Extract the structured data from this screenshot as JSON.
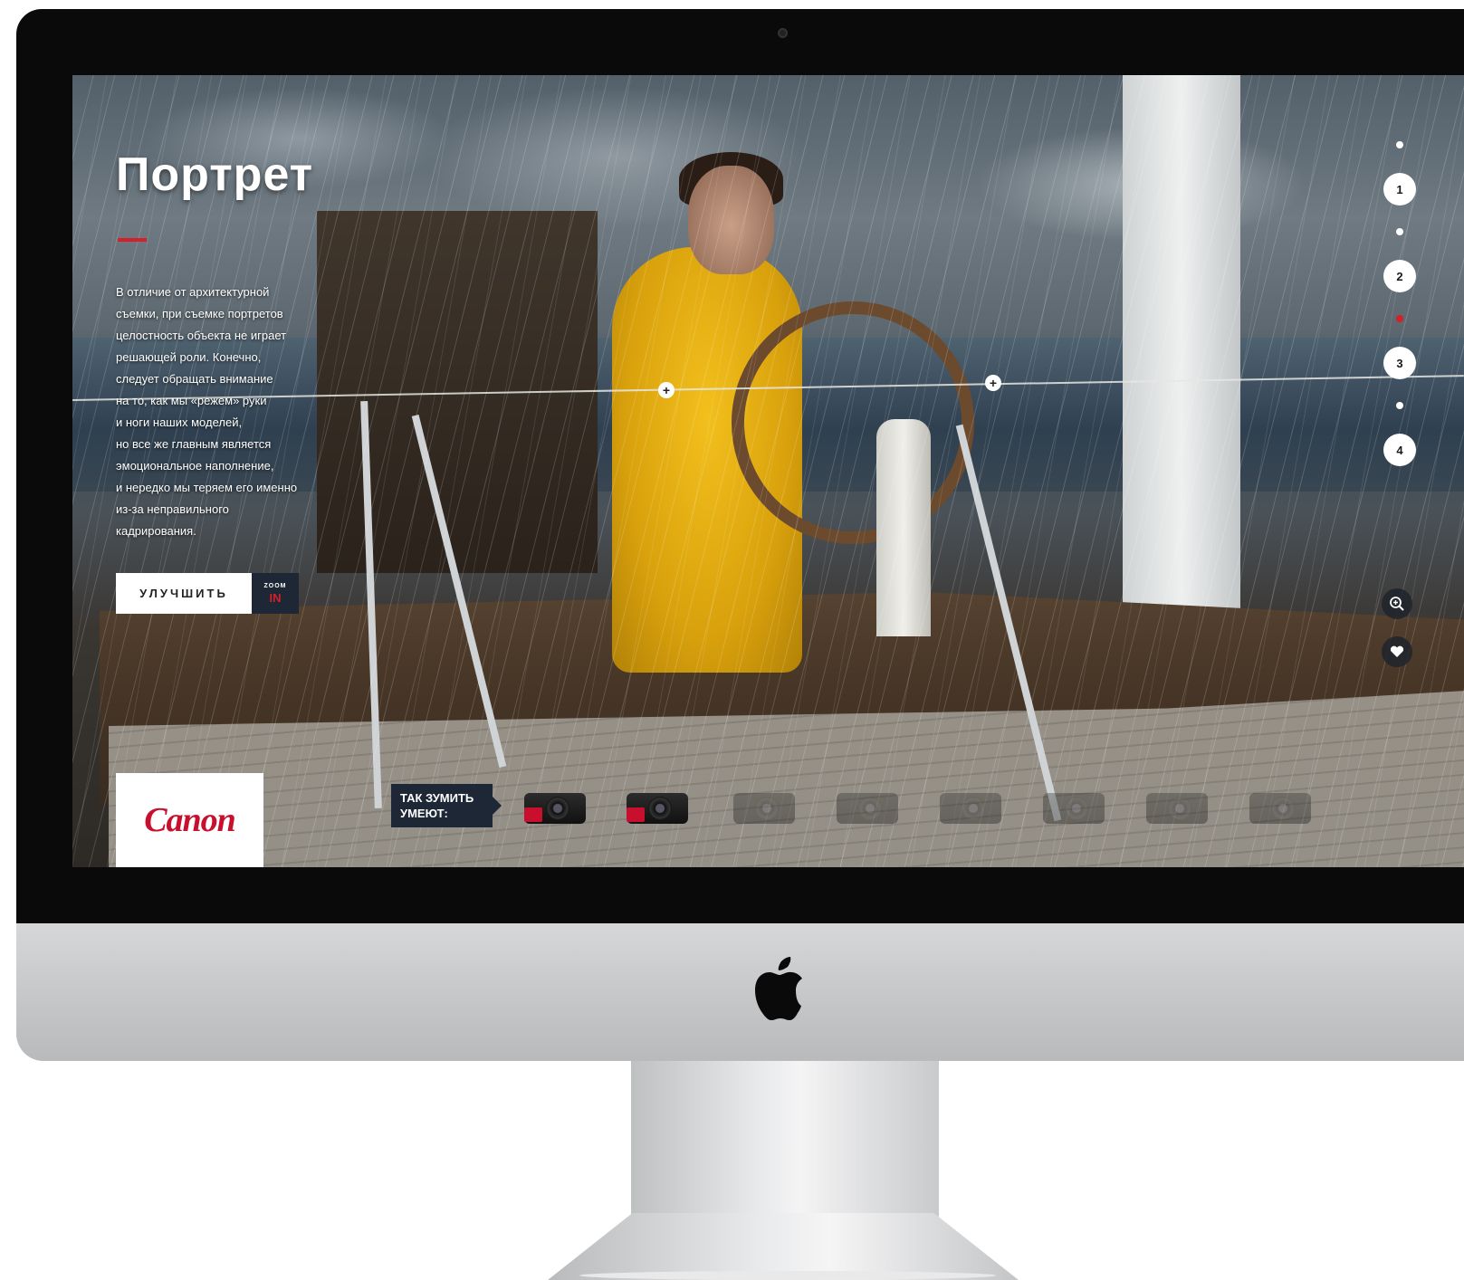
{
  "page": {
    "title": "Портрет",
    "description": "В отличие от архитектурной\nсъемки, при съемке портретов\nцелостность объекта не играет\nрешающей роли. Конечно,\nследует обращать внимание\nна то, как мы «режем» руки\nи ноги наших моделей,\nно все же главным является\nэмоциональное наполнение,\nи нередко мы теряем его именно\nиз-за неправильного\nкадрирования."
  },
  "cta": {
    "label": "УЛУЧШИТЬ",
    "zoom_word": "ZOOM",
    "zoom_in": "IN"
  },
  "nav": {
    "steps": [
      "1",
      "2",
      "3",
      "4"
    ],
    "active_dot_index": 2
  },
  "brand": {
    "logo_text": "Canon"
  },
  "footer": {
    "zoom_label": "ТАК ЗУМИТЬ\nУМЕЮТ:",
    "cameras": [
      {
        "name": "camera-1",
        "badge": "ZOOM",
        "active": true
      },
      {
        "name": "camera-2",
        "badge": "ZOOM",
        "active": true
      },
      {
        "name": "camera-3",
        "active": false
      },
      {
        "name": "camera-4",
        "active": false
      },
      {
        "name": "camera-5",
        "active": false
      },
      {
        "name": "camera-6",
        "active": false
      },
      {
        "name": "camera-7",
        "active": false
      },
      {
        "name": "camera-8",
        "active": false
      }
    ]
  },
  "icons": {
    "zoom": "zoom-in-icon",
    "favorite": "heart-icon",
    "hotspot": "plus-icon",
    "device_logo": "apple-icon"
  },
  "colors": {
    "accent": "#d4202a",
    "brand_red": "#c8102e",
    "dark_panel": "#1d2735",
    "coat_yellow": "#e2ab10"
  }
}
